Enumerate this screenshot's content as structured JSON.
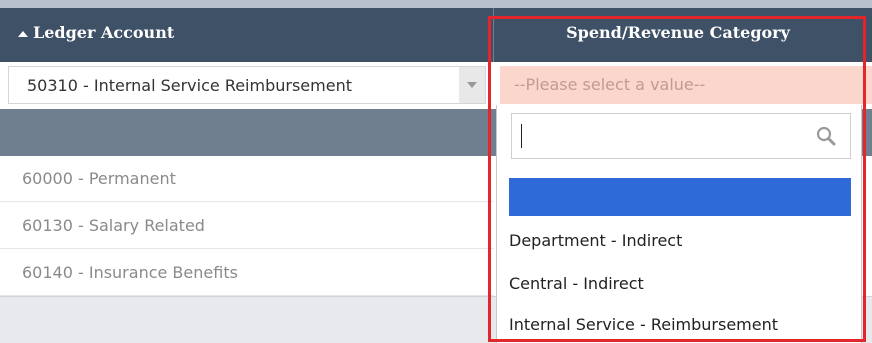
{
  "header": {
    "ledger_label": "Ledger Account",
    "spend_label": "Spend/Revenue Category",
    "sort_icon": "sort-up-icon"
  },
  "row1": {
    "ledger_value": "50310 - Internal Service Reimbursement",
    "spend_placeholder": "--Please select a value--"
  },
  "ledger_rows": [
    "60000 - Permanent",
    "60130 - Salary Related",
    "60140 - Insurance Benefits"
  ],
  "dropdown": {
    "search_value": "",
    "options": [
      "",
      "Department - Indirect",
      "Central - Indirect",
      "Internal Service - Reimbursement"
    ],
    "selected_index": 0
  },
  "colors": {
    "header_bg": "#3f5167",
    "band_bg": "#6f7f90",
    "select_required_bg": "#fbd6cc",
    "option_highlight": "#2f6ad9",
    "annotation_red": "#e3262b"
  }
}
